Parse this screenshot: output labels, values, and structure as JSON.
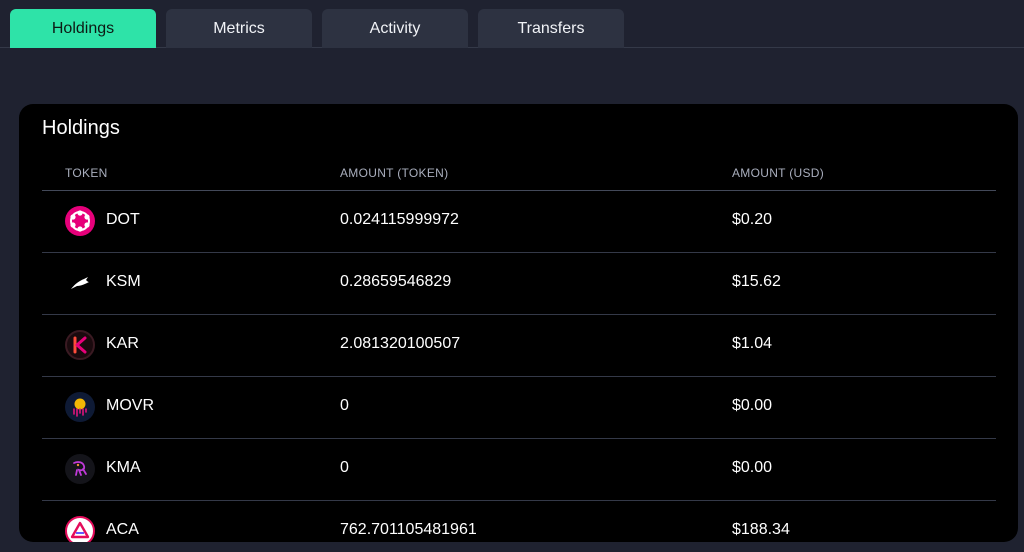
{
  "tabs": [
    {
      "label": "Holdings",
      "active": true
    },
    {
      "label": "Metrics",
      "active": false
    },
    {
      "label": "Activity",
      "active": false
    },
    {
      "label": "Transfers",
      "active": false
    }
  ],
  "holdings": {
    "title": "Holdings",
    "columns": {
      "token": "TOKEN",
      "amount_token": "AMOUNT (TOKEN)",
      "amount_usd": "AMOUNT (USD)"
    },
    "rows": [
      {
        "symbol": "DOT",
        "amount": "0.024115999972",
        "usd": "$0.20",
        "icon": "polkadot-icon"
      },
      {
        "symbol": "KSM",
        "amount": "0.28659546829",
        "usd": "$15.62",
        "icon": "kusama-icon"
      },
      {
        "symbol": "KAR",
        "amount": "2.081320100507",
        "usd": "$1.04",
        "icon": "karura-icon"
      },
      {
        "symbol": "MOVR",
        "amount": "0",
        "usd": "$0.00",
        "icon": "moonriver-icon"
      },
      {
        "symbol": "KMA",
        "amount": "0",
        "usd": "$0.00",
        "icon": "calamari-icon"
      },
      {
        "symbol": "ACA",
        "amount": "762.701105481961",
        "usd": "$188.34",
        "icon": "acala-icon"
      }
    ]
  },
  "colors": {
    "background": "#1f2230",
    "tab": "#2d3241",
    "active_tab": "#2ee3a8",
    "card": "#000000",
    "divider": "#343948"
  }
}
